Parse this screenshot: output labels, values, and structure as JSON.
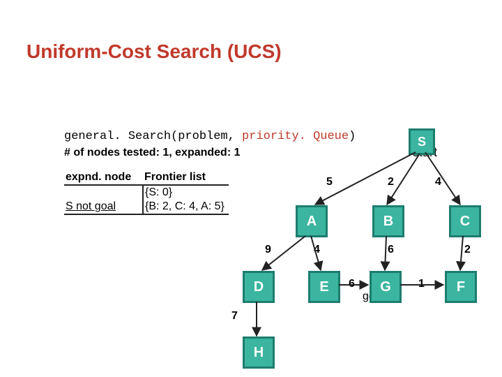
{
  "title": "Uniform-Cost Search (UCS)",
  "code_prefix": "general. Search(problem, ",
  "code_keyword": "priority. Queue",
  "code_suffix": ")",
  "stats": "# of nodes tested: 1, expanded: 1",
  "table": {
    "h0": "expnd. node",
    "h1": "Frontier list",
    "r1c0": "",
    "r1c1": "{S: 0}",
    "r2c0": "S not goal",
    "r2c1": "{B: 2, C: 4, A: 5}"
  },
  "start_label": "start",
  "goal_label": "goal",
  "nodes": {
    "S": "S",
    "A": "A",
    "B": "B",
    "C": "C",
    "D": "D",
    "E": "E",
    "F": "F",
    "G": "G",
    "H": "H"
  },
  "weights": {
    "SA": "5",
    "SB": "2",
    "SC": "4",
    "AD": "9",
    "AE": "4",
    "BG": "6",
    "CF": "2",
    "EG": "6",
    "GF": "1",
    "DH": "7"
  }
}
